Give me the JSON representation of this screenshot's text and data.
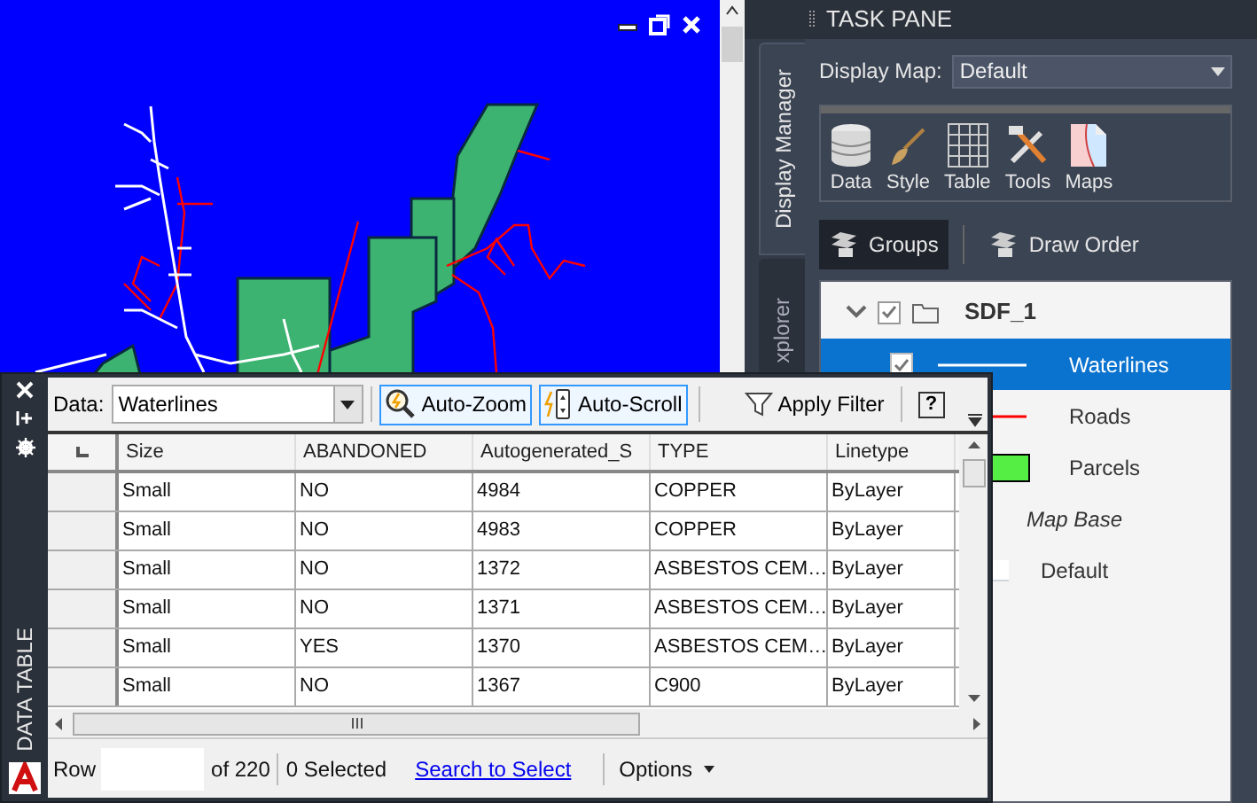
{
  "task_pane": {
    "title": "TASK PANE",
    "side_tabs": [
      {
        "label": "Display Manager",
        "selected": true
      },
      {
        "label": "xplorer",
        "selected": false
      }
    ],
    "display_map": {
      "label": "Display Map:",
      "value": "Default"
    },
    "tools": [
      {
        "label": "Data",
        "kind": "data"
      },
      {
        "label": "Style",
        "kind": "style"
      },
      {
        "label": "Table",
        "kind": "table"
      },
      {
        "label": "Tools",
        "kind": "tools"
      },
      {
        "label": "Maps",
        "kind": "maps"
      }
    ],
    "view_buttons": [
      {
        "label": "Groups",
        "selected": true
      },
      {
        "label": "Draw Order",
        "selected": false
      }
    ],
    "tree": {
      "group": {
        "name": "SDF_1",
        "expanded": true,
        "checked": true
      },
      "entries": [
        {
          "name": "Waterlines",
          "kind": "line",
          "color": "#ffffff",
          "selected": true,
          "checked": true
        },
        {
          "name": "Roads",
          "kind": "line",
          "color": "#ff0000",
          "selected": false
        },
        {
          "name": "Parcels",
          "kind": "fill",
          "color": "#55ee44",
          "selected": false
        },
        {
          "name": "Map Base",
          "kind": "heading",
          "selected": false
        },
        {
          "name": "Default",
          "kind": "style",
          "selected": false
        }
      ]
    }
  },
  "data_table": {
    "title": "DATA TABLE",
    "toolbar": {
      "data_label": "Data:",
      "data_value": "Waterlines",
      "buttons": [
        {
          "label": "Auto-Zoom",
          "kind": "zoom",
          "selected": true
        },
        {
          "label": "Auto-Scroll",
          "kind": "scroll",
          "selected": true
        },
        {
          "label": "Apply Filter",
          "kind": "filter",
          "selected": false
        }
      ],
      "help": "?"
    },
    "columns": [
      "Size",
      "ABANDONED",
      "Autogenerated_S",
      "TYPE",
      "Linetype"
    ],
    "rows": [
      [
        "Small",
        "NO",
        "4984",
        "COPPER",
        "ByLayer"
      ],
      [
        "Small",
        "NO",
        "4983",
        "COPPER",
        "ByLayer"
      ],
      [
        "Small",
        "NO",
        "1372",
        "ASBESTOS CEM…",
        "ByLayer"
      ],
      [
        "Small",
        "NO",
        "1371",
        "ASBESTOS CEM…",
        "ByLayer"
      ],
      [
        "Small",
        "YES",
        "1370",
        "ASBESTOS CEM…",
        "ByLayer"
      ],
      [
        "Small",
        "NO",
        "1367",
        "C900",
        "ByLayer"
      ]
    ],
    "status": {
      "row_label": "Row",
      "of_total": "of 220",
      "selected": "0 Selected",
      "search_link": "Search to Select",
      "options": "Options"
    }
  }
}
